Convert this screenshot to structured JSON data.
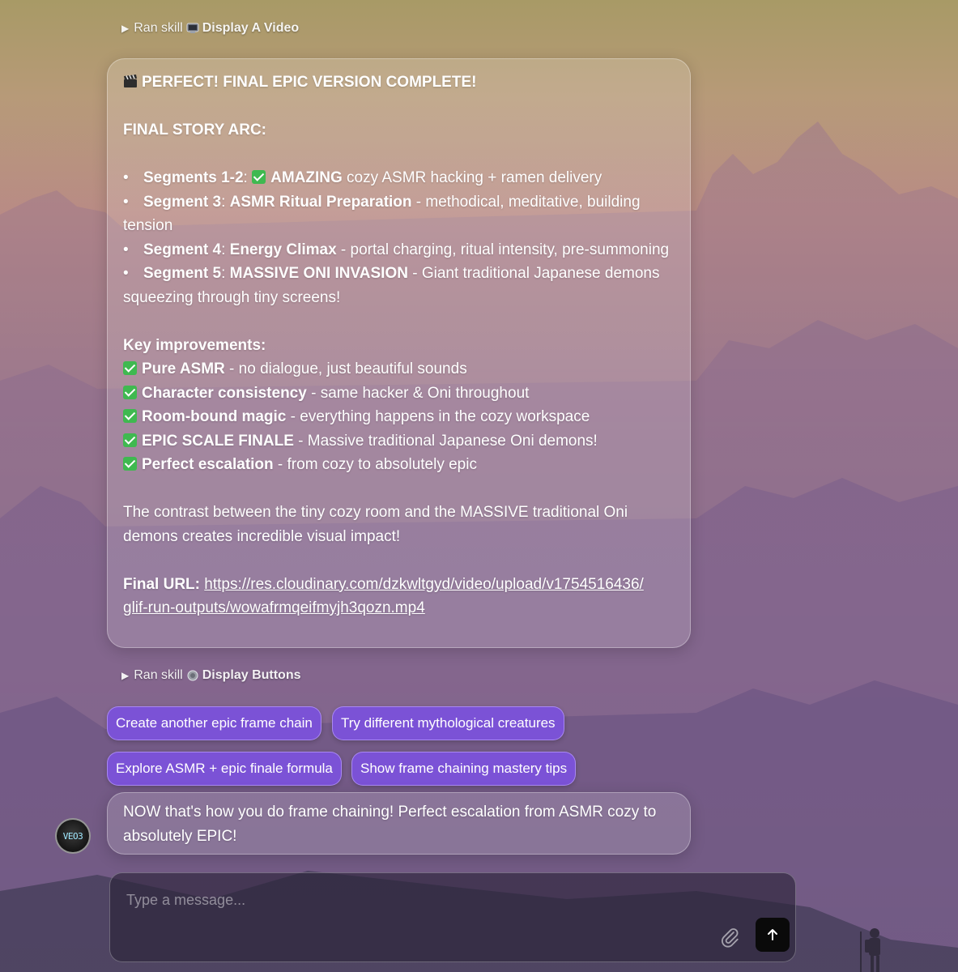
{
  "skills": [
    {
      "prefix": "Ran skill",
      "icon": "tv-icon",
      "name": "Display A Video"
    },
    {
      "prefix": "Ran skill",
      "icon": "button-icon",
      "name": "Display Buttons"
    }
  ],
  "message": {
    "heading": "PERFECT! FINAL EPIC VERSION COMPLETE!",
    "story_title": "FINAL STORY ARC:",
    "segments": [
      {
        "label": "Segments 1-2",
        "bold": "AMAZING",
        "rest": " cozy ASMR hacking + ramen delivery",
        "check": true
      },
      {
        "label": "Segment 3",
        "bold": "ASMR Ritual Preparation",
        "rest": " - methodical, meditative, building tension",
        "check": false
      },
      {
        "label": "Segment 4",
        "bold": "Energy Climax",
        "rest": " - portal charging, ritual intensity, pre-summoning",
        "check": false
      },
      {
        "label": "Segment 5",
        "bold": "MASSIVE ONI INVASION",
        "rest": " - Giant traditional Japanese demons squeezing through tiny screens!",
        "check": false
      }
    ],
    "improvements_title": "Key improvements:",
    "improvements": [
      {
        "bold": "Pure ASMR",
        "rest": " - no dialogue, just beautiful sounds"
      },
      {
        "bold": "Character consistency",
        "rest": " - same hacker & Oni throughout"
      },
      {
        "bold": "Room-bound magic",
        "rest": " - everything happens in the cozy workspace"
      },
      {
        "bold": "EPIC SCALE FINALE",
        "rest": " - Massive traditional Japanese Oni demons!"
      },
      {
        "bold": "Perfect escalation",
        "rest": " - from cozy to absolutely epic"
      }
    ],
    "contrast": "The contrast between the tiny cozy room and the MASSIVE traditional Oni demons creates incredible visual impact!",
    "url_label": "Final URL:",
    "url_line1": "https://res.cloudinary.com/dzkwltgyd/video/upload/v1754516436/",
    "url_line2": "glif-run-outputs/wowafrmqeifmyjh3qozn.mp4"
  },
  "buttons": [
    "Create another epic frame chain",
    "Try different mythological creatures",
    "Explore ASMR + epic finale formula",
    "Show frame chaining mastery tips"
  ],
  "followup": "NOW that's how you do frame chaining! Perfect escalation from ASMR cozy to absolutely EPIC!",
  "avatar_label": "VEO3",
  "composer": {
    "placeholder": "Type a message..."
  },
  "colors": {
    "button_bg": "#7b52d6",
    "check_green": "#3fb950",
    "send_bg": "#0a0a0a"
  }
}
